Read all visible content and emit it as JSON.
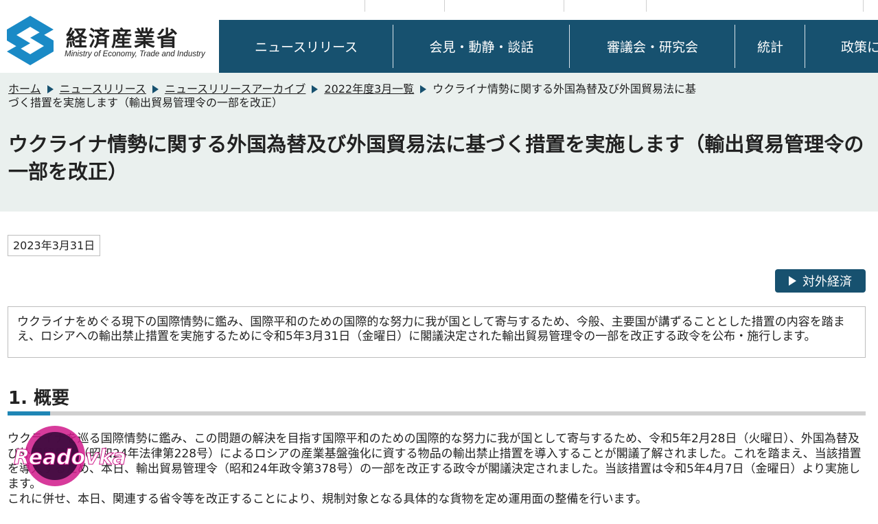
{
  "header": {
    "logo_jp": "経済産業省",
    "logo_en": "Ministry of Economy, Trade and Industry",
    "nav": [
      {
        "label": "ニュースリリース"
      },
      {
        "label": "会見・動静・談話"
      },
      {
        "label": "審議会・研究会"
      },
      {
        "label": "統計"
      },
      {
        "label": "政策に"
      }
    ]
  },
  "breadcrumb": {
    "items": [
      "ホーム",
      "ニュースリリース",
      "ニュースリリースアーカイブ",
      "2022年度3月一覧"
    ],
    "current": "ウクライナ情勢に関する外国為替及び外国貿易法に基づく措置を実施します（輸出貿易管理令の一部を改正）"
  },
  "article": {
    "title": "ウクライナ情勢に関する外国為替及び外国貿易法に基づく措置を実施します（輸出貿易管理令の一部を改正）",
    "date": "2023年3月31日",
    "tag": "対外経済",
    "summary": "ウクライナをめぐる現下の国際情勢に鑑み、国際平和のための国際的な努力に我が国として寄与するため、今般、主要国が講ずることとした措置の内容を踏まえ、ロシアへの輸出禁止措置を実施するために令和5年3月31日（金曜日）に閣議決定された輸出貿易管理令の一部を改正する政令を公布・施行します。",
    "section_heading": "1. 概要",
    "body_p1": "ウクライナを巡る国際情勢に鑑み、この問題の解決を目指す国際平和のための国際的な努力に我が国として寄与するため、令和5年2月28日（火曜日）、外国為替及び外国貿易法（昭和24年法律第228号）によるロシアの産業基盤強化に資する物品の輸出禁止措置を導入することが閣議了解されました。これを踏まえ、当該措置を導入するため、本日、輸出貿易管理令（昭和24年政令第378号）の一部を改正する政令が閣議決定されました。当該措置は令和5年4月7日（金曜日）より実施します。",
    "body_p2": "これに併せ、本日、関連する省令等を改正することにより、規制対象となる具体的な貨物を定め運用面の整備を行います。"
  },
  "watermark": {
    "text": "Readovka"
  },
  "colors": {
    "nav_bg": "#17516f",
    "band_bg": "#eaf0ee",
    "accent": "#1f86b5",
    "logo_blue": "#1a8ac6"
  },
  "icons": [
    "meti-logo-icon",
    "breadcrumb-arrow-icon",
    "tag-triangle-icon"
  ]
}
